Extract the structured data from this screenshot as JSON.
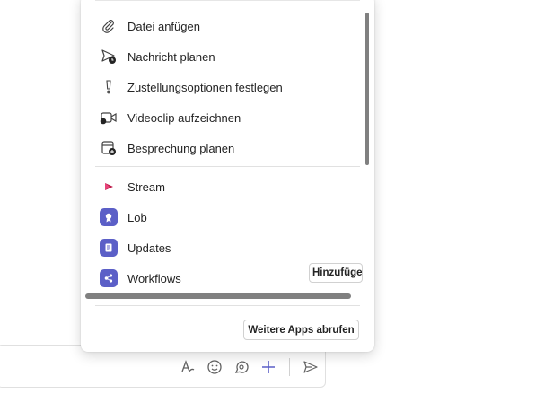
{
  "menu": {
    "actions": [
      {
        "label": "Datei anfügen",
        "icon": "paperclip-icon"
      },
      {
        "label": "Nachricht planen",
        "icon": "send-clock-icon"
      },
      {
        "label": "Zustellungsoptionen festlegen",
        "icon": "exclamation-icon"
      },
      {
        "label": "Videoclip aufzeichnen",
        "icon": "video-clip-icon"
      },
      {
        "label": "Besprechung planen",
        "icon": "calendar-add-icon"
      }
    ],
    "apps": [
      {
        "label": "Stream",
        "icon": "stream-icon",
        "color": "#bc1948"
      },
      {
        "label": "Lob",
        "icon": "praise-icon",
        "color": "#5b5fc7"
      },
      {
        "label": "Updates",
        "icon": "updates-icon",
        "color": "#5b5fc7"
      },
      {
        "label": "Workflows",
        "icon": "workflows-icon",
        "color": "#5b5fc7"
      }
    ],
    "add_label": "Hinzufügen",
    "more_apps_label": "Weitere Apps abrufen"
  },
  "compose_toolbar": {
    "icons": [
      "format-icon",
      "emoji-icon",
      "loop-icon",
      "plus-icon",
      "send-icon"
    ],
    "accent": "#5b5fc7"
  }
}
